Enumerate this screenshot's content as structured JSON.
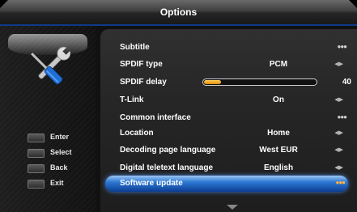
{
  "window": {
    "title": "Options"
  },
  "keys": [
    {
      "label": "Enter"
    },
    {
      "label": "Select"
    },
    {
      "label": "Back"
    },
    {
      "label": "Exit"
    }
  ],
  "menu": {
    "items": [
      {
        "label": "Subtitle",
        "value": "",
        "indicator": "dots"
      },
      {
        "label": "SPDIF type",
        "value": "PCM",
        "indicator": "arrows"
      },
      {
        "label": "SPDIF delay",
        "value": "40",
        "indicator": "slider",
        "slider_fraction": 0.15
      },
      {
        "label": "T-Link",
        "value": "On",
        "indicator": "arrows"
      },
      {
        "label": "Common interface",
        "value": "",
        "indicator": "dots"
      },
      {
        "label": "Location",
        "value": "Home",
        "indicator": "arrows"
      },
      {
        "label": "Decoding page language",
        "value": "West EUR",
        "indicator": "arrows"
      },
      {
        "label": "Digital teletext language",
        "value": "English",
        "indicator": "arrows"
      },
      {
        "label": "Software update",
        "value": "",
        "indicator": "dots",
        "selected": true
      }
    ]
  },
  "colors": {
    "accent": "#1f5fbf",
    "slider_fill": "#f0a020"
  },
  "icons": {
    "tools": "wrench-screwdriver-icon",
    "more": "more-dots-icon",
    "scroll": "chevron-down-icon"
  }
}
